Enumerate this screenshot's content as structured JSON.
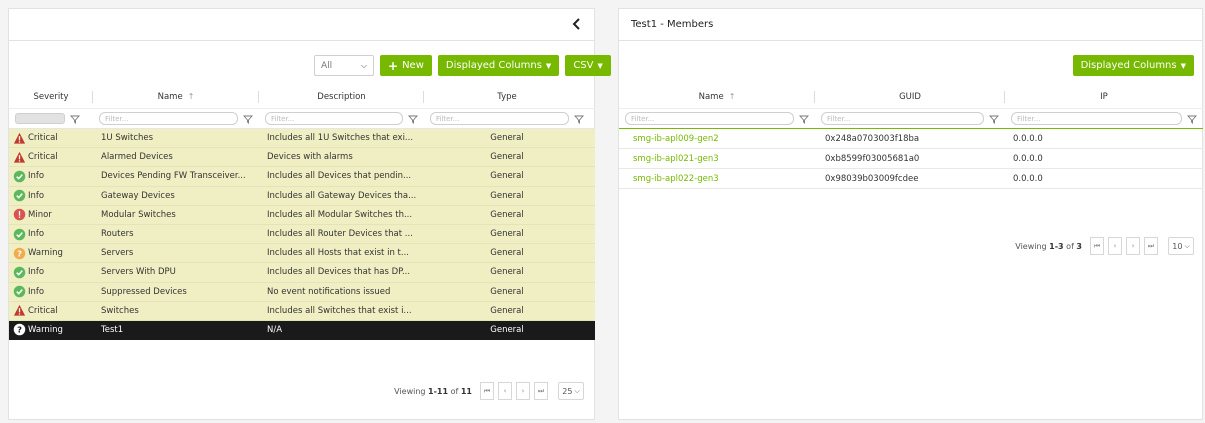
{
  "left": {
    "toolbar": {
      "filter_select": "All",
      "new_label": "New",
      "columns_label": "Displayed Columns",
      "csv_label": "CSV"
    },
    "columns": {
      "severity": "Severity",
      "name": "Name",
      "name_sort": "↑",
      "description": "Description",
      "type": "Type"
    },
    "filter_placeholder": "Filter...",
    "rows": [
      {
        "severity": "Critical",
        "icon": "critical-triangle-icon",
        "name": "1U Switches",
        "description": "Includes all 1U Switches that exi...",
        "type": "General"
      },
      {
        "severity": "Critical",
        "icon": "critical-triangle-icon",
        "name": "Alarmed Devices",
        "description": "Devices with alarms",
        "type": "General"
      },
      {
        "severity": "Info",
        "icon": "info-check-icon",
        "name": "Devices Pending FW Transceiver...",
        "description": "Includes all Devices that pendin...",
        "type": "General"
      },
      {
        "severity": "Info",
        "icon": "info-check-icon",
        "name": "Gateway Devices",
        "description": "Includes all Gateway Devices tha...",
        "type": "General"
      },
      {
        "severity": "Minor",
        "icon": "minor-exclamation-icon",
        "name": "Modular Switches",
        "description": "Includes all Modular Switches th...",
        "type": "General"
      },
      {
        "severity": "Info",
        "icon": "info-check-icon",
        "name": "Routers",
        "description": "Includes all Router Devices that ...",
        "type": "General"
      },
      {
        "severity": "Warning",
        "icon": "warning-question-icon",
        "name": "Servers",
        "description": "Includes all Hosts that exist in t...",
        "type": "General"
      },
      {
        "severity": "Info",
        "icon": "info-check-icon",
        "name": "Servers With DPU",
        "description": "Includes all Devices that has DP...",
        "type": "General"
      },
      {
        "severity": "Info",
        "icon": "info-check-icon",
        "name": "Suppressed Devices",
        "description": "No event notifications issued",
        "type": "General"
      },
      {
        "severity": "Critical",
        "icon": "critical-triangle-icon",
        "name": "Switches",
        "description": "Includes all Switches that exist i...",
        "type": "General"
      },
      {
        "severity": "Warning",
        "icon": "warning-question-icon",
        "name": "Test1",
        "description": "N/A",
        "type": "General",
        "selected": true
      }
    ],
    "pager": {
      "viewing_prefix": "Viewing ",
      "range": "1-11",
      "of_label": " of ",
      "total": "11",
      "per_page": "25"
    }
  },
  "right": {
    "title": "Test1 - Members",
    "columns_label": "Displayed Columns",
    "columns": {
      "name": "Name",
      "name_sort": "↑",
      "guid": "GUID",
      "ip": "IP"
    },
    "filter_placeholder": "Filter...",
    "rows": [
      {
        "name": "smg-ib-apl009-gen2",
        "guid": "0x248a0703003f18ba",
        "ip": "0.0.0.0"
      },
      {
        "name": "smg-ib-apl021-gen3",
        "guid": "0xb8599f03005681a0",
        "ip": "0.0.0.0"
      },
      {
        "name": "smg-ib-apl022-gen3",
        "guid": "0x98039b03009fcdee",
        "ip": "0.0.0.0"
      }
    ],
    "pager": {
      "viewing_prefix": "Viewing ",
      "range": "1-3",
      "of_label": " of ",
      "total": "3",
      "per_page": "10"
    }
  },
  "colors": {
    "accent": "#76b900",
    "critical": "#c0392b",
    "info": "#5cb85c",
    "minor": "#d9534f",
    "warning": "#f0ad4e",
    "row_highlight": "#f0efc4",
    "row_selected": "#1a1a1a"
  }
}
